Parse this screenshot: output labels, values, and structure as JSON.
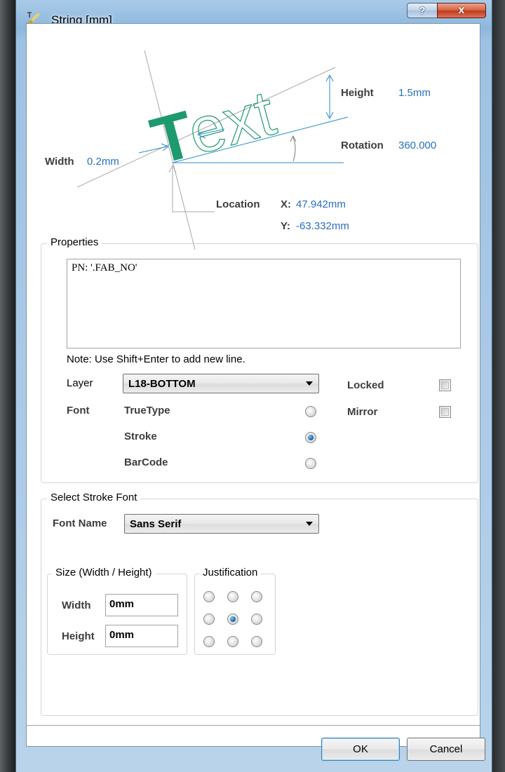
{
  "window": {
    "title": "String  [mm]",
    "help_label": "?",
    "close_label": "x"
  },
  "diagram": {
    "sample_text_first": "T",
    "sample_text_rest": "ext",
    "height_label": "Height",
    "height_value": "1.5mm",
    "rotation_label": "Rotation",
    "rotation_value": "360.000",
    "width_label": "Width",
    "width_value": "0.2mm",
    "location_label": "Location",
    "x_label": "X:",
    "x_value": "47.942mm",
    "y_label": "Y:",
    "y_value": "-63.332mm",
    "accent_color": "#2a6fc0",
    "text_color": "#1e9a6e"
  },
  "properties": {
    "title": "Properties",
    "text_value": "PN: '.FAB_NO'",
    "note": "Note: Use Shift+Enter to add new line.",
    "layer_label": "Layer",
    "layer_value": "L18-BOTTOM",
    "locked_label": "Locked",
    "locked_checked": false,
    "mirror_label": "Mirror",
    "mirror_checked": false,
    "font_label": "Font",
    "font_options": [
      {
        "label": "TrueType",
        "selected": false
      },
      {
        "label": "Stroke",
        "selected": true
      },
      {
        "label": "BarCode",
        "selected": false
      }
    ]
  },
  "stroke_font": {
    "title": "Select Stroke Font",
    "font_name_label": "Font Name",
    "font_name_value": "Sans Serif",
    "size_group_title": "Size (Width / Height)",
    "width_label": "Width",
    "width_value": "0mm",
    "height_label": "Height",
    "height_value": "0mm",
    "justification_title": "Justification",
    "justification_selected": "middle-center"
  },
  "buttons": {
    "ok_label": "OK",
    "cancel_label": "Cancel"
  }
}
